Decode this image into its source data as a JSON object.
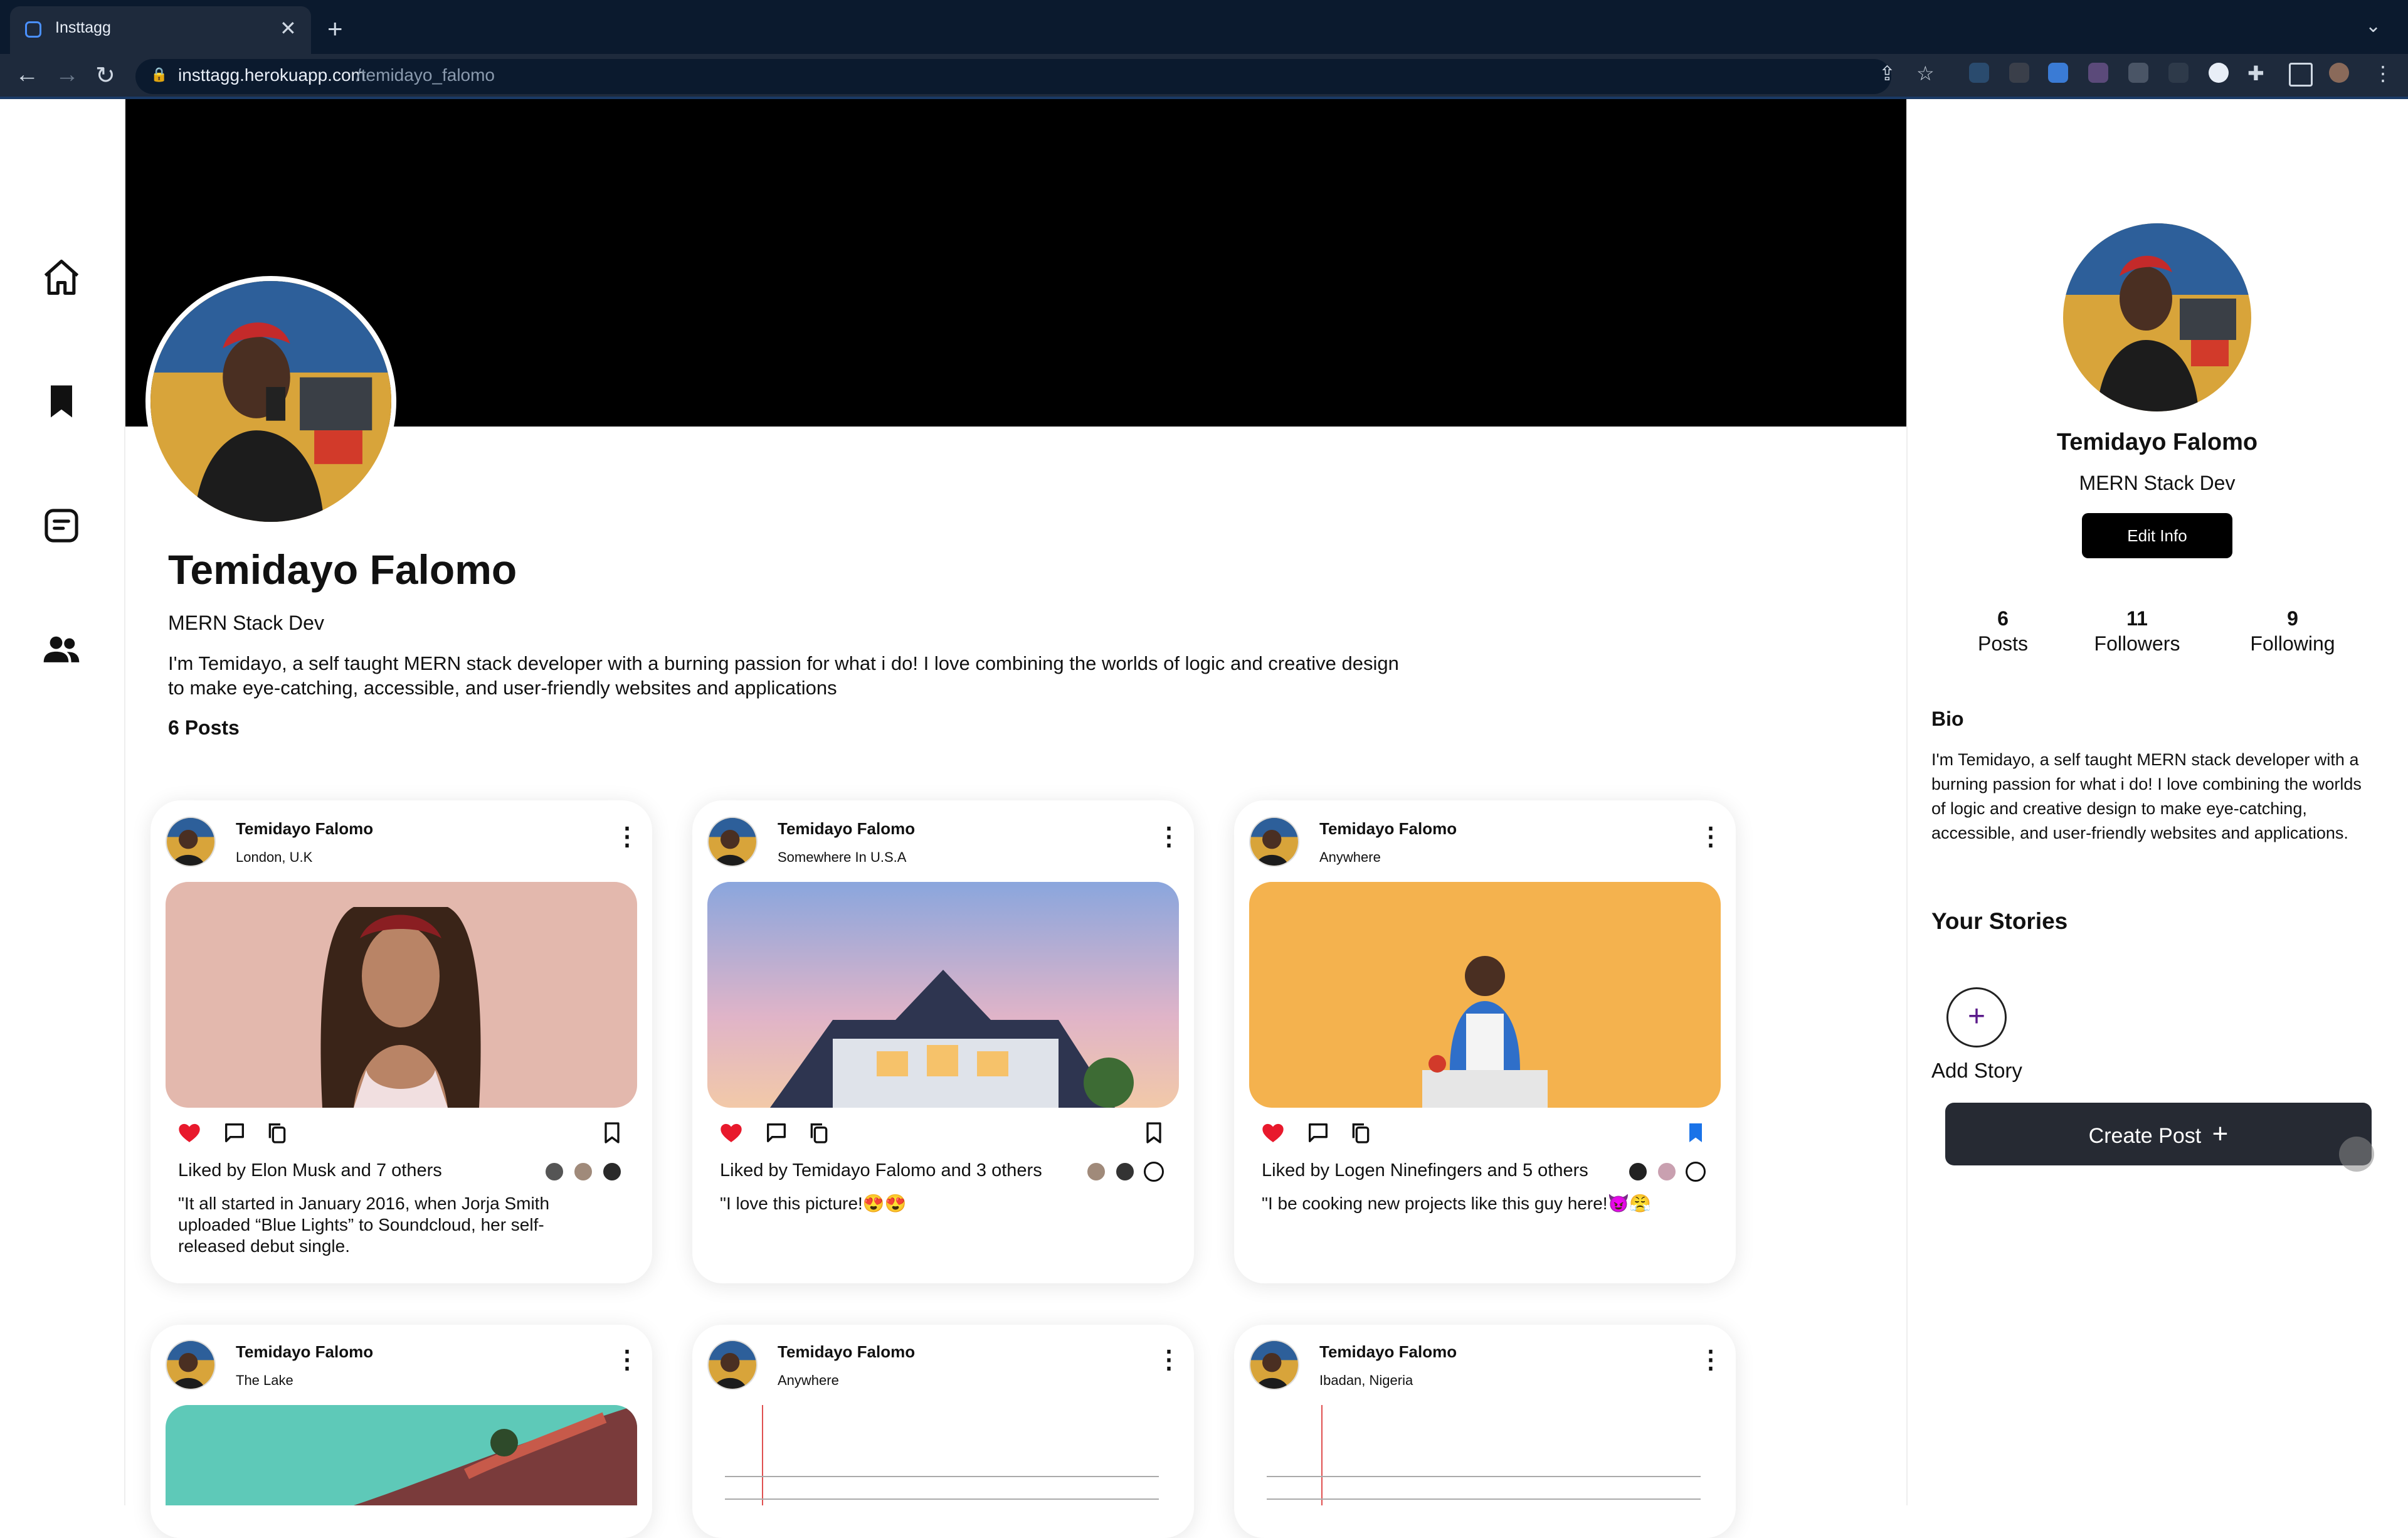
{
  "browser": {
    "tab_title": "Insttagg",
    "url_host": "insttagg.herokuapp.com",
    "url_path": "/temidayo_falomo"
  },
  "profile": {
    "name": "Temidayo Falomo",
    "role": "MERN Stack Dev",
    "bio": "I'm Temidayo, a self taught MERN stack developer with a burning passion for what i do! I love combining the worlds of logic and creative design to make eye-catching, accessible, and user-friendly websites and applications",
    "posts_label": "6 Posts"
  },
  "posts": [
    {
      "author": "Temidayo Falomo",
      "location": "London, U.K",
      "liked_by": "Liked by Elon Musk and 7 others",
      "caption": "\"It all started in January 2016, when Jorja Smith uploaded “Blue Lights” to Soundcloud, her self-released debut single.",
      "liked": true,
      "saved": false
    },
    {
      "author": "Temidayo Falomo",
      "location": "Somewhere In U.S.A",
      "liked_by": "Liked by Temidayo Falomo and 3 others",
      "caption": "\"I love this picture!😍😍",
      "liked": true,
      "saved": false
    },
    {
      "author": "Temidayo Falomo",
      "location": "Anywhere",
      "liked_by": "Liked by Logen Ninefingers and 5 others",
      "caption": "\"I be cooking new projects like this guy here!😈😤",
      "liked": true,
      "saved": true
    },
    {
      "author": "Temidayo Falomo",
      "location": "The Lake"
    },
    {
      "author": "Temidayo Falomo",
      "location": "Anywhere"
    },
    {
      "author": "Temidayo Falomo",
      "location": "Ibadan, Nigeria"
    }
  ],
  "sidebar": {
    "name": "Temidayo Falomo",
    "role": "MERN Stack Dev",
    "edit_label": "Edit Info",
    "stats": [
      {
        "value": "6",
        "label": "Posts"
      },
      {
        "value": "11",
        "label": "Followers"
      },
      {
        "value": "9",
        "label": "Following"
      }
    ],
    "bio_heading": "Bio",
    "bio": "I'm Temidayo, a self taught MERN stack developer with a burning passion for what i do! I love combining the worlds of logic and creative design to make eye-catching, accessible, and user-friendly websites and applications.",
    "stories_heading": "Your Stories",
    "add_story_label": "Add Story",
    "create_post_label": "Create Post"
  },
  "colors": {
    "like": "#e8192c",
    "saved": "#1a73e8",
    "accent": "#5a1a8a"
  }
}
